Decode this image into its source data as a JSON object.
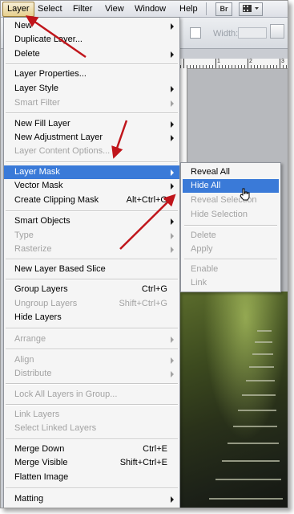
{
  "menubar": {
    "items": [
      "Layer",
      "Select",
      "Filter",
      "View",
      "Window",
      "Help"
    ],
    "icon_br": "Br"
  },
  "options": {
    "width_label": "Width:"
  },
  "ruler": {
    "numbers": [
      "1",
      "2",
      "3"
    ]
  },
  "menu": {
    "items": [
      {
        "label": "New",
        "shortcut": "",
        "submenu": true,
        "enabled": true
      },
      {
        "label": "Duplicate Layer...",
        "shortcut": "",
        "submenu": false,
        "enabled": true
      },
      {
        "label": "Delete",
        "shortcut": "",
        "submenu": true,
        "enabled": true
      },
      {
        "label": "Layer Properties...",
        "shortcut": "",
        "submenu": false,
        "enabled": true
      },
      {
        "label": "Layer Style",
        "shortcut": "",
        "submenu": true,
        "enabled": true
      },
      {
        "label": "Smart Filter",
        "shortcut": "",
        "submenu": true,
        "enabled": false
      },
      {
        "label": "New Fill Layer",
        "shortcut": "",
        "submenu": true,
        "enabled": true
      },
      {
        "label": "New Adjustment Layer",
        "shortcut": "",
        "submenu": true,
        "enabled": true
      },
      {
        "label": "Layer Content Options...",
        "shortcut": "",
        "submenu": false,
        "enabled": false
      },
      {
        "label": "Layer Mask",
        "shortcut": "",
        "submenu": true,
        "enabled": true
      },
      {
        "label": "Vector Mask",
        "shortcut": "",
        "submenu": true,
        "enabled": true
      },
      {
        "label": "Create Clipping Mask",
        "shortcut": "Alt+Ctrl+G",
        "submenu": false,
        "enabled": true
      },
      {
        "label": "Smart Objects",
        "shortcut": "",
        "submenu": true,
        "enabled": true
      },
      {
        "label": "Type",
        "shortcut": "",
        "submenu": true,
        "enabled": false
      },
      {
        "label": "Rasterize",
        "shortcut": "",
        "submenu": true,
        "enabled": false
      },
      {
        "label": "New Layer Based Slice",
        "shortcut": "",
        "submenu": false,
        "enabled": true
      },
      {
        "label": "Group Layers",
        "shortcut": "Ctrl+G",
        "submenu": false,
        "enabled": true
      },
      {
        "label": "Ungroup Layers",
        "shortcut": "Shift+Ctrl+G",
        "submenu": false,
        "enabled": false
      },
      {
        "label": "Hide Layers",
        "shortcut": "",
        "submenu": false,
        "enabled": true
      },
      {
        "label": "Arrange",
        "shortcut": "",
        "submenu": true,
        "enabled": false
      },
      {
        "label": "Align",
        "shortcut": "",
        "submenu": true,
        "enabled": false
      },
      {
        "label": "Distribute",
        "shortcut": "",
        "submenu": true,
        "enabled": false
      },
      {
        "label": "Lock All Layers in Group...",
        "shortcut": "",
        "submenu": false,
        "enabled": false
      },
      {
        "label": "Link Layers",
        "shortcut": "",
        "submenu": false,
        "enabled": false
      },
      {
        "label": "Select Linked Layers",
        "shortcut": "",
        "submenu": false,
        "enabled": false
      },
      {
        "label": "Merge Down",
        "shortcut": "Ctrl+E",
        "submenu": false,
        "enabled": true
      },
      {
        "label": "Merge Visible",
        "shortcut": "Shift+Ctrl+E",
        "submenu": false,
        "enabled": true
      },
      {
        "label": "Flatten Image",
        "shortcut": "",
        "submenu": false,
        "enabled": true
      },
      {
        "label": "Matting",
        "shortcut": "",
        "submenu": true,
        "enabled": true
      }
    ]
  },
  "submenu": {
    "items": [
      {
        "label": "Reveal All",
        "enabled": true
      },
      {
        "label": "Hide All",
        "enabled": true
      },
      {
        "label": "Reveal Selection",
        "enabled": false
      },
      {
        "label": "Hide Selection",
        "enabled": false
      },
      {
        "label": "Delete",
        "enabled": false
      },
      {
        "label": "Apply",
        "enabled": false
      },
      {
        "label": "Enable",
        "enabled": false
      },
      {
        "label": "Link",
        "enabled": false
      }
    ]
  },
  "colors": {
    "highlight": "#3a7ad8",
    "annotation_arrow": "#c0151b",
    "disabled_text": "#a3a3a3"
  }
}
